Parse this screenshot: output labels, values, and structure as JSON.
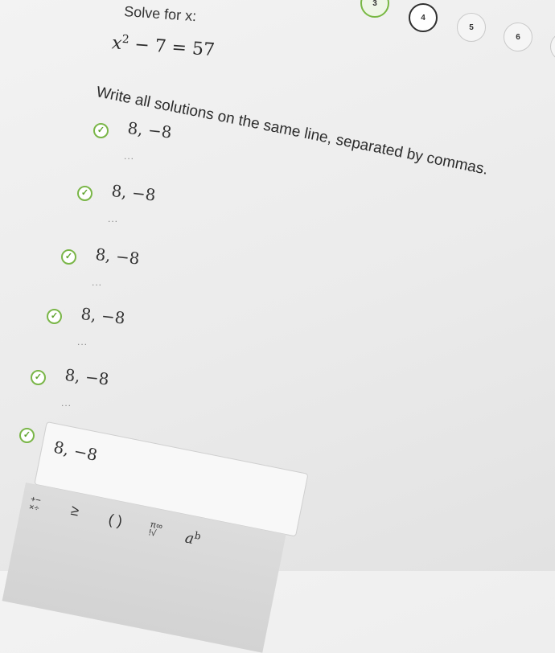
{
  "steps": [
    {
      "label": "3",
      "state": "done"
    },
    {
      "label": "4",
      "state": "current"
    },
    {
      "label": "5",
      "state": "todo"
    },
    {
      "label": "6",
      "state": "todo"
    }
  ],
  "question": {
    "prompt": "Solve for x:",
    "equation_lhs": "x",
    "equation_exp": "2",
    "equation_rhs": " − 7 = 57",
    "instruction": "Write all solutions on the same line, separated by commas."
  },
  "attempts": [
    {
      "answer": "8, −8",
      "more": "..."
    },
    {
      "answer": "8, −8",
      "more": "..."
    },
    {
      "answer": "8, −8",
      "more": "..."
    },
    {
      "answer": "8, −8",
      "more": "..."
    },
    {
      "answer": "8, −8",
      "more": "..."
    }
  ],
  "final_attempt": {
    "mark": "✓"
  },
  "input": {
    "value": "8, −8"
  },
  "toolbar": {
    "ops_label": "+−\n×÷",
    "compare_label": "≥",
    "paren_label": "( )",
    "misc_label": "π∞\n!√",
    "power_base": "a",
    "power_exp": "b"
  },
  "colors": {
    "check": "#7ab648",
    "current_step_border": "#2f2f2f"
  }
}
